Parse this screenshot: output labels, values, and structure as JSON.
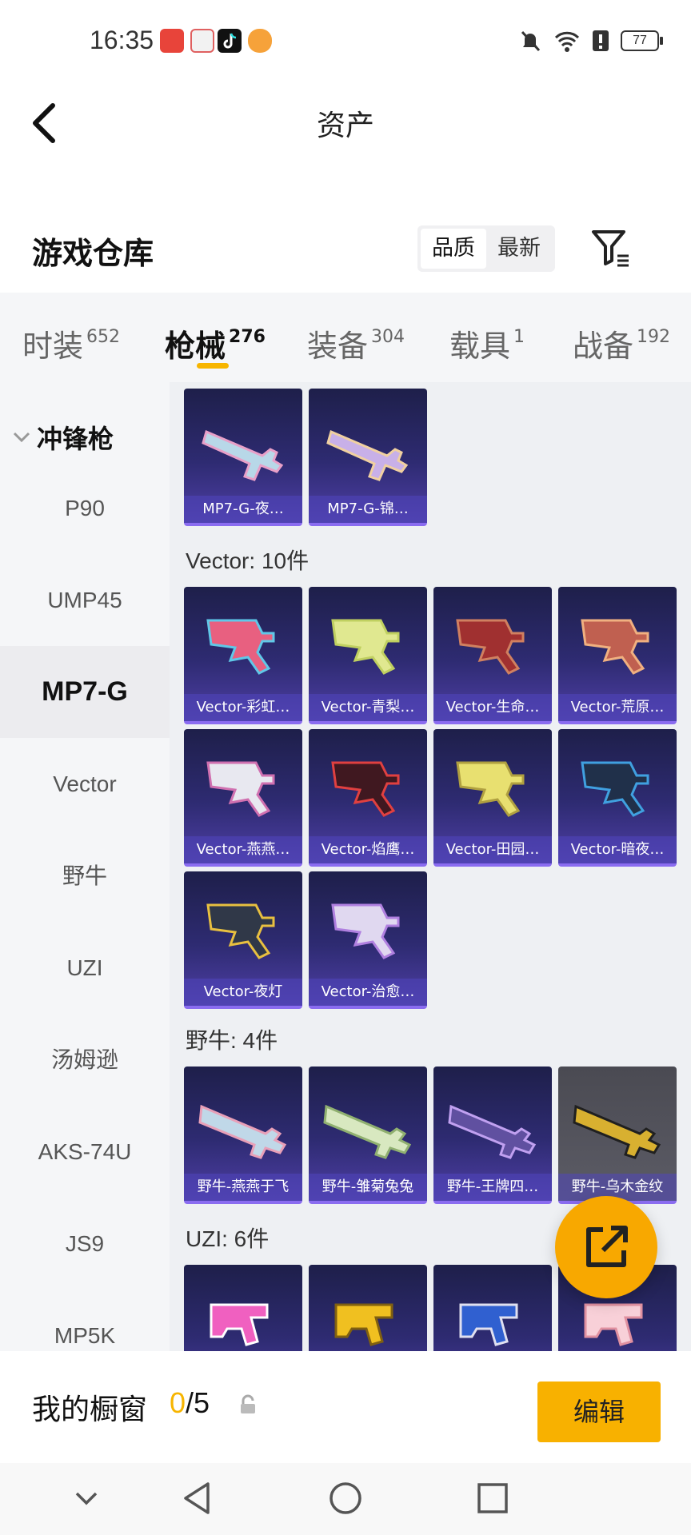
{
  "status_bar": {
    "time": "16:35",
    "battery": "77",
    "notification_icons": [
      "huawei-store-icon",
      "app-box-icon",
      "tiktok-icon",
      "cat-app-icon"
    ],
    "right_icons": [
      "mute-icon",
      "wifi-icon",
      "alert-icon",
      "battery-icon"
    ]
  },
  "header": {
    "title": "资产",
    "back_icon": "back-arrow-icon"
  },
  "warehouse": {
    "title": "游戏仓库",
    "sort_options": [
      "品质",
      "最新"
    ],
    "sort_selected": "品质",
    "filter_icon": "filter-icon"
  },
  "tabs": [
    {
      "label": "时装",
      "count": "652"
    },
    {
      "label": "枪械",
      "count": "276"
    },
    {
      "label": "装备",
      "count": "304"
    },
    {
      "label": "载具",
      "count": "1"
    },
    {
      "label": "战备",
      "count": "192"
    }
  ],
  "tab_selected": "枪械",
  "sidebar": {
    "group": "冲锋枪",
    "items": [
      "P90",
      "UMP45",
      "MP7-G",
      "Vector",
      "野牛",
      "UZI",
      "汤姆逊",
      "AKS-74U",
      "JS9",
      "MP5K"
    ],
    "selected": "MP7-G"
  },
  "sections": [
    {
      "label": "",
      "items": [
        "MP7-G-夜…",
        "MP7-G-锦…"
      ]
    },
    {
      "label": "Vector: 10件",
      "items": [
        "Vector-彩虹…",
        "Vector-青梨…",
        "Vector-生命…",
        "Vector-荒原…",
        "Vector-燕燕…",
        "Vector-焰鹰…",
        "Vector-田园…",
        "Vector-暗夜…",
        "Vector-夜灯",
        "Vector-治愈…"
      ]
    },
    {
      "label": "野牛: 4件",
      "items": [
        "野牛-燕燕于飞",
        "野牛-雏菊兔兔",
        "野牛-王牌四…",
        "野牛-乌木金纹"
      ]
    },
    {
      "label": "UZI: 6件",
      "items": [
        "",
        "",
        "",
        ""
      ]
    }
  ],
  "showcase": {
    "label": "我的橱窗",
    "current": "0",
    "total": "/5",
    "edit_label": "编辑"
  },
  "colors": {
    "accent": "#F7B500",
    "card_purple": "#2E2B72",
    "fab": "#F8A800"
  }
}
